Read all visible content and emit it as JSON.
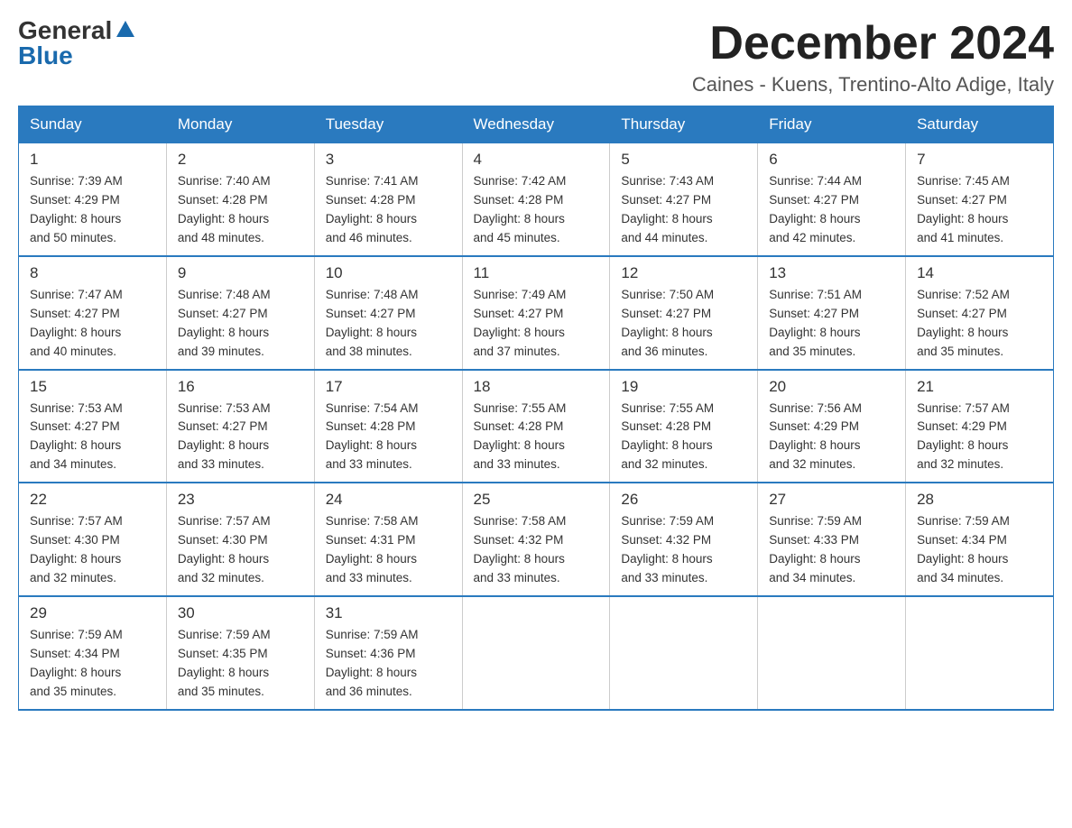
{
  "header": {
    "logo": {
      "general": "General",
      "blue": "Blue"
    },
    "title": "December 2024",
    "location": "Caines - Kuens, Trentino-Alto Adige, Italy"
  },
  "weekdays": [
    "Sunday",
    "Monday",
    "Tuesday",
    "Wednesday",
    "Thursday",
    "Friday",
    "Saturday"
  ],
  "weeks": [
    [
      {
        "day": "1",
        "sunrise": "7:39 AM",
        "sunset": "4:29 PM",
        "daylight": "8 hours and 50 minutes."
      },
      {
        "day": "2",
        "sunrise": "7:40 AM",
        "sunset": "4:28 PM",
        "daylight": "8 hours and 48 minutes."
      },
      {
        "day": "3",
        "sunrise": "7:41 AM",
        "sunset": "4:28 PM",
        "daylight": "8 hours and 46 minutes."
      },
      {
        "day": "4",
        "sunrise": "7:42 AM",
        "sunset": "4:28 PM",
        "daylight": "8 hours and 45 minutes."
      },
      {
        "day": "5",
        "sunrise": "7:43 AM",
        "sunset": "4:27 PM",
        "daylight": "8 hours and 44 minutes."
      },
      {
        "day": "6",
        "sunrise": "7:44 AM",
        "sunset": "4:27 PM",
        "daylight": "8 hours and 42 minutes."
      },
      {
        "day": "7",
        "sunrise": "7:45 AM",
        "sunset": "4:27 PM",
        "daylight": "8 hours and 41 minutes."
      }
    ],
    [
      {
        "day": "8",
        "sunrise": "7:47 AM",
        "sunset": "4:27 PM",
        "daylight": "8 hours and 40 minutes."
      },
      {
        "day": "9",
        "sunrise": "7:48 AM",
        "sunset": "4:27 PM",
        "daylight": "8 hours and 39 minutes."
      },
      {
        "day": "10",
        "sunrise": "7:48 AM",
        "sunset": "4:27 PM",
        "daylight": "8 hours and 38 minutes."
      },
      {
        "day": "11",
        "sunrise": "7:49 AM",
        "sunset": "4:27 PM",
        "daylight": "8 hours and 37 minutes."
      },
      {
        "day": "12",
        "sunrise": "7:50 AM",
        "sunset": "4:27 PM",
        "daylight": "8 hours and 36 minutes."
      },
      {
        "day": "13",
        "sunrise": "7:51 AM",
        "sunset": "4:27 PM",
        "daylight": "8 hours and 35 minutes."
      },
      {
        "day": "14",
        "sunrise": "7:52 AM",
        "sunset": "4:27 PM",
        "daylight": "8 hours and 35 minutes."
      }
    ],
    [
      {
        "day": "15",
        "sunrise": "7:53 AM",
        "sunset": "4:27 PM",
        "daylight": "8 hours and 34 minutes."
      },
      {
        "day": "16",
        "sunrise": "7:53 AM",
        "sunset": "4:27 PM",
        "daylight": "8 hours and 33 minutes."
      },
      {
        "day": "17",
        "sunrise": "7:54 AM",
        "sunset": "4:28 PM",
        "daylight": "8 hours and 33 minutes."
      },
      {
        "day": "18",
        "sunrise": "7:55 AM",
        "sunset": "4:28 PM",
        "daylight": "8 hours and 33 minutes."
      },
      {
        "day": "19",
        "sunrise": "7:55 AM",
        "sunset": "4:28 PM",
        "daylight": "8 hours and 32 minutes."
      },
      {
        "day": "20",
        "sunrise": "7:56 AM",
        "sunset": "4:29 PM",
        "daylight": "8 hours and 32 minutes."
      },
      {
        "day": "21",
        "sunrise": "7:57 AM",
        "sunset": "4:29 PM",
        "daylight": "8 hours and 32 minutes."
      }
    ],
    [
      {
        "day": "22",
        "sunrise": "7:57 AM",
        "sunset": "4:30 PM",
        "daylight": "8 hours and 32 minutes."
      },
      {
        "day": "23",
        "sunrise": "7:57 AM",
        "sunset": "4:30 PM",
        "daylight": "8 hours and 32 minutes."
      },
      {
        "day": "24",
        "sunrise": "7:58 AM",
        "sunset": "4:31 PM",
        "daylight": "8 hours and 33 minutes."
      },
      {
        "day": "25",
        "sunrise": "7:58 AM",
        "sunset": "4:32 PM",
        "daylight": "8 hours and 33 minutes."
      },
      {
        "day": "26",
        "sunrise": "7:59 AM",
        "sunset": "4:32 PM",
        "daylight": "8 hours and 33 minutes."
      },
      {
        "day": "27",
        "sunrise": "7:59 AM",
        "sunset": "4:33 PM",
        "daylight": "8 hours and 34 minutes."
      },
      {
        "day": "28",
        "sunrise": "7:59 AM",
        "sunset": "4:34 PM",
        "daylight": "8 hours and 34 minutes."
      }
    ],
    [
      {
        "day": "29",
        "sunrise": "7:59 AM",
        "sunset": "4:34 PM",
        "daylight": "8 hours and 35 minutes."
      },
      {
        "day": "30",
        "sunrise": "7:59 AM",
        "sunset": "4:35 PM",
        "daylight": "8 hours and 35 minutes."
      },
      {
        "day": "31",
        "sunrise": "7:59 AM",
        "sunset": "4:36 PM",
        "daylight": "8 hours and 36 minutes."
      },
      null,
      null,
      null,
      null
    ]
  ],
  "labels": {
    "sunrise": "Sunrise:",
    "sunset": "Sunset:",
    "daylight": "Daylight:"
  }
}
